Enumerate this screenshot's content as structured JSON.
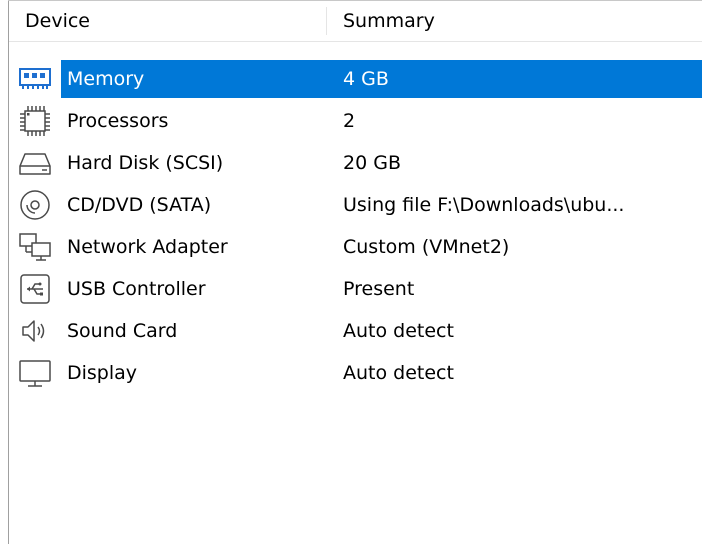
{
  "header": {
    "device_col": "Device",
    "summary_col": "Summary"
  },
  "rows": [
    {
      "device": "Memory",
      "summary": "4 GB",
      "icon": "memory-icon",
      "selected": true
    },
    {
      "device": "Processors",
      "summary": "2",
      "icon": "processor-icon",
      "selected": false
    },
    {
      "device": "Hard Disk (SCSI)",
      "summary": "20 GB",
      "icon": "hard-disk-icon",
      "selected": false
    },
    {
      "device": "CD/DVD (SATA)",
      "summary": "Using file F:\\Downloads\\ubu...",
      "icon": "cd-dvd-icon",
      "selected": false
    },
    {
      "device": "Network Adapter",
      "summary": "Custom (VMnet2)",
      "icon": "network-adapter-icon",
      "selected": false
    },
    {
      "device": "USB Controller",
      "summary": "Present",
      "icon": "usb-icon",
      "selected": false
    },
    {
      "device": "Sound Card",
      "summary": "Auto detect",
      "icon": "speaker-icon",
      "selected": false
    },
    {
      "device": "Display",
      "summary": "Auto detect",
      "icon": "monitor-icon",
      "selected": false
    }
  ],
  "colors": {
    "selection": "#0078d7",
    "border": "#a0a0a0",
    "icon": "#4a4a4a",
    "memory_icon": "#1e6fd0"
  }
}
